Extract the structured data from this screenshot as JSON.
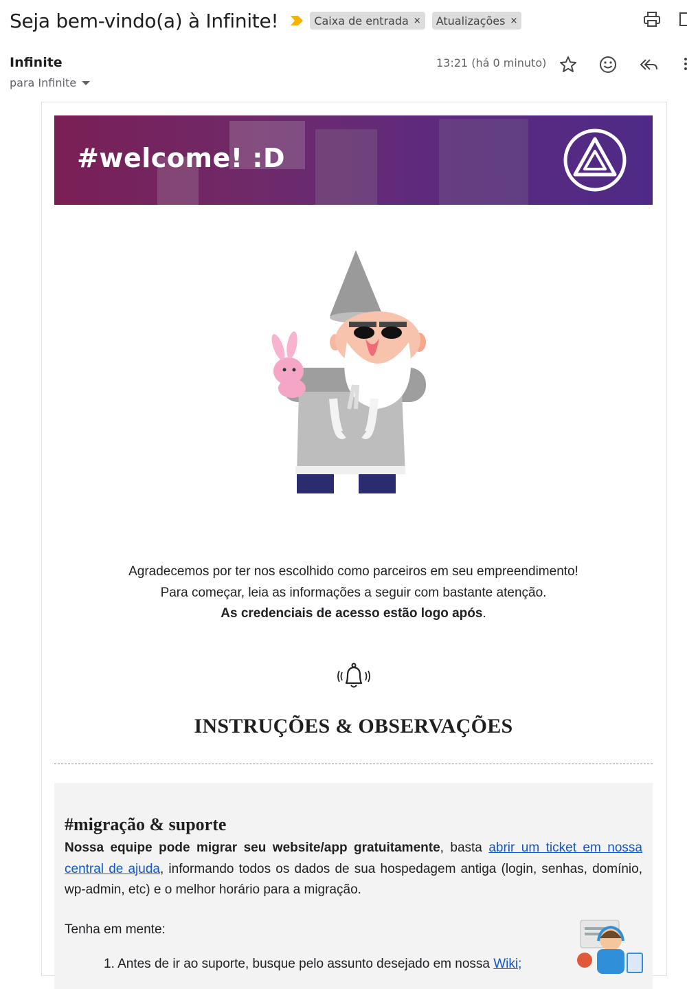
{
  "header": {
    "subject": "Seja bem-vindo(a) à Infinite!",
    "labels": [
      {
        "name": "Caixa de entrada",
        "remove": "×"
      },
      {
        "name": "Atualizações",
        "remove": "×"
      }
    ]
  },
  "message": {
    "sender": "Infinite",
    "recipient": "para Infinite",
    "time": "13:21 (há 0 minuto)"
  },
  "email": {
    "banner_text": "#welcome! :D",
    "intro": [
      "Agradecemos por ter nos escolhido como parceiros em seu empreendimento!",
      "Para começar, leia as informações a seguir com bastante atenção."
    ],
    "intro_bold": "As credenciais de acesso estão logo após",
    "intro_bold_end": ".",
    "section_title": "INSTRUÇÕES & OBSERVAÇÕES",
    "migration": {
      "heading": "#migração & suporte",
      "bold_lead": "Nossa equipe pode migrar seu website/app gratuitamente",
      "text_1": ", basta ",
      "link": "abrir um ticket em nossa central de ajuda",
      "text_2": ", informando todos os dados de sua hospedagem antiga (login, senhas, domínio, wp-admin, etc) e o melhor horário para a migração.",
      "keep_in_mind": "Tenha em mente:",
      "item_1_number": "1.",
      "item_1_text": "Antes de ir ao suporte, busque pelo assunto desejado em nossa ",
      "item_1_link": "Wiki;"
    }
  },
  "colors": {
    "banner_start": "#7a1f55",
    "banner_end": "#4e2a86",
    "link": "#1155cc",
    "importance_marker": "#f4b400"
  }
}
